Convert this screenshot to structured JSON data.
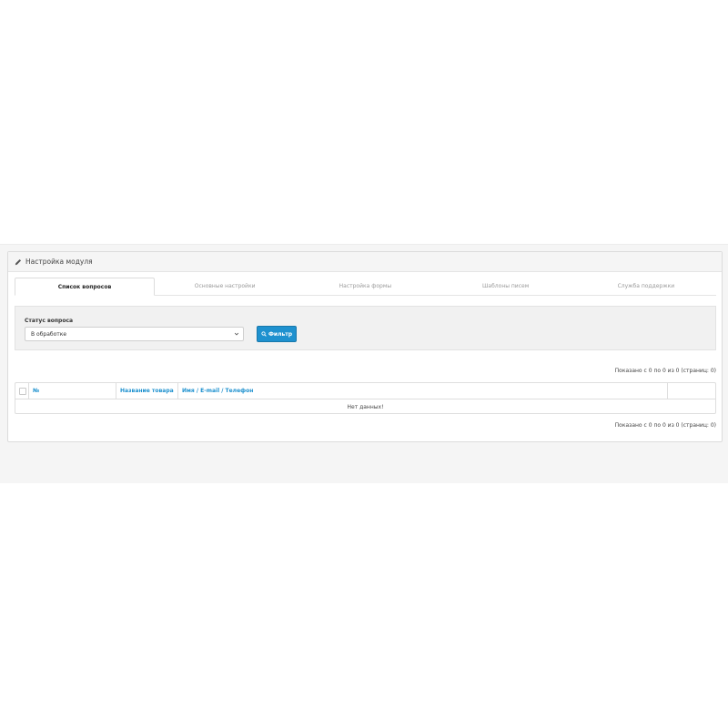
{
  "panel": {
    "title": "Настройка модуля",
    "title_icon": "pencil-icon"
  },
  "tabs": [
    {
      "label": "Список вопросов",
      "active": true
    },
    {
      "label": "Основные настройки",
      "active": false
    },
    {
      "label": "Настройка формы",
      "active": false
    },
    {
      "label": "Шаблоны писем",
      "active": false
    },
    {
      "label": "Служба поддержки",
      "active": false
    }
  ],
  "filter": {
    "status_label": "Статус вопроса",
    "status_value": "В обработке",
    "button_label": "Фильтр",
    "button_icon": "search-icon",
    "accent_color": "#1e91cf"
  },
  "pagination": {
    "top_text": "Показано с 0 по 0 из 0 (страниц: 0)",
    "bottom_text": "Показано с 0 по 0 из 0 (страниц: 0)"
  },
  "table": {
    "columns": [
      "№",
      "Название товара",
      "Имя / E-mail / Телефон",
      ""
    ],
    "empty_text": "Нет данных!"
  }
}
